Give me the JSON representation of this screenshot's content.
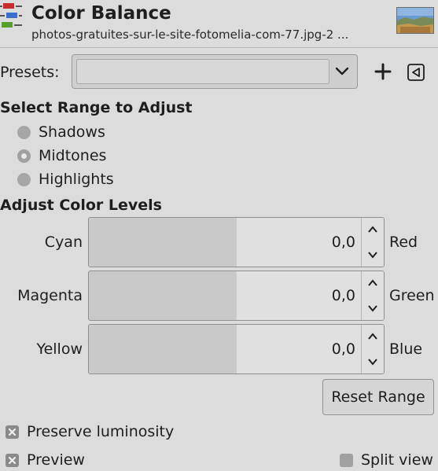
{
  "header": {
    "title": "Color Balance",
    "subtitle": "photos-gratuites-sur-le-site-fotomelia-com-77.jpg-2 ...",
    "icon": "color-balance-icon",
    "thumbnail_icon": "image-thumbnail"
  },
  "presets": {
    "label": "Presets:",
    "selected": "",
    "add_icon": "plus-icon",
    "menu_icon": "triangle-left-icon"
  },
  "range": {
    "title": "Select Range to Adjust",
    "options": [
      {
        "label": "Shadows",
        "checked": false
      },
      {
        "label": "Midtones",
        "checked": true
      },
      {
        "label": "Highlights",
        "checked": false
      }
    ]
  },
  "levels": {
    "title": "Adjust Color Levels",
    "sliders": [
      {
        "left": "Cyan",
        "right": "Red",
        "value": "0,0",
        "fraction": 0.5
      },
      {
        "left": "Magenta",
        "right": "Green",
        "value": "0,0",
        "fraction": 0.5
      },
      {
        "left": "Yellow",
        "right": "Blue",
        "value": "0,0",
        "fraction": 0.5
      }
    ],
    "reset_label": "Reset Range"
  },
  "options": {
    "preserve_luminosity": {
      "label": "Preserve luminosity",
      "checked": true
    },
    "preview": {
      "label": "Preview",
      "checked": true
    },
    "split_view": {
      "label": "Split view",
      "checked": false
    }
  }
}
